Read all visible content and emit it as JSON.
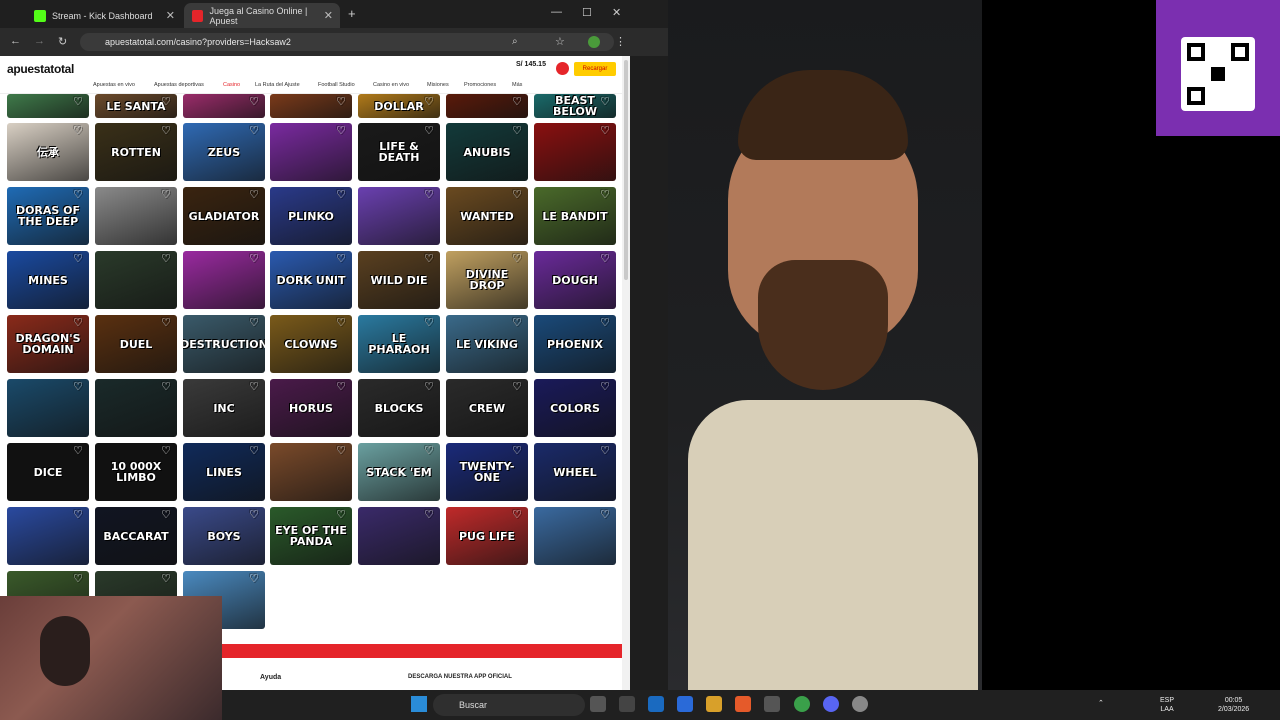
{
  "browser": {
    "tabs": [
      {
        "label": "Stream - Kick Dashboard",
        "active": false
      },
      {
        "label": "Juega al Casino Online | Apuest",
        "active": true
      }
    ],
    "url": "apuestatotal.com/casino?providers=Hacksaw2"
  },
  "site": {
    "logo": "apuestatotal",
    "nav": [
      "Apuestas en vivo",
      "Apuestas deportivas",
      "Casino",
      "La Ruta del Ajuste",
      "Football Studio",
      "Casino en vivo",
      "Misiones",
      "Promociones",
      "Más"
    ],
    "active_nav": "Casino",
    "balance": "S/ 145.15",
    "recharge_label": "Recargar"
  },
  "games": [
    {
      "title": "",
      "color": "#3f7a4a"
    },
    {
      "title": "LE SANTA",
      "color": "#6b4a2b"
    },
    {
      "title": "",
      "color": "#9a2c6a"
    },
    {
      "title": "",
      "color": "#7a3a1a"
    },
    {
      "title": "DOLLAR",
      "color": "#b07a1a"
    },
    {
      "title": "",
      "color": "#5a1a0a"
    },
    {
      "title": "BEAST BELOW",
      "color": "#1a6a6a"
    },
    {
      "title": "伝承",
      "color": "#d9d0c4"
    },
    {
      "title": "ROTTEN",
      "color": "#3a3018"
    },
    {
      "title": "ZEUS",
      "color": "#2f6ab4"
    },
    {
      "title": "",
      "color": "#7a2aa0"
    },
    {
      "title": "LIFE & DEATH",
      "color": "#1a1a1a"
    },
    {
      "title": "ANUBIS",
      "color": "#123a3a"
    },
    {
      "title": "",
      "color": "#8a1010"
    },
    {
      "title": "DORAS OF THE DEEP",
      "color": "#1f6bb5"
    },
    {
      "title": "",
      "color": "#8a8a8a"
    },
    {
      "title": "GLADIATOR",
      "color": "#3a2410"
    },
    {
      "title": "PLINKO",
      "color": "#2a3a8a"
    },
    {
      "title": "",
      "color": "#6a40b0"
    },
    {
      "title": "WANTED",
      "color": "#6a4a20"
    },
    {
      "title": "LE BANDIT",
      "color": "#4a6a2a"
    },
    {
      "title": "MINES",
      "color": "#1a4aa0"
    },
    {
      "title": "",
      "color": "#2a3a2a"
    },
    {
      "title": "",
      "color": "#9a2aa0"
    },
    {
      "title": "DORK UNIT",
      "color": "#2a5ab0"
    },
    {
      "title": "WILD DIE",
      "color": "#5a4020"
    },
    {
      "title": "DIVINE DROP",
      "color": "#c0a060"
    },
    {
      "title": "DOUGH",
      "color": "#6a2a9a"
    },
    {
      "title": "DRAGON'S DOMAIN",
      "color": "#8a2a1a"
    },
    {
      "title": "DUEL",
      "color": "#5a3010"
    },
    {
      "title": "DESTRUCTION",
      "color": "#3a5a6a"
    },
    {
      "title": "CLOWNS",
      "color": "#7a5a1a"
    },
    {
      "title": "LE PHARAOH",
      "color": "#2a7aa0"
    },
    {
      "title": "LE VIKING",
      "color": "#3a6a8a"
    },
    {
      "title": "PHOENIX",
      "color": "#1a4a7a"
    },
    {
      "title": "",
      "color": "#1a4a6a"
    },
    {
      "title": "",
      "color": "#1a2a2a"
    },
    {
      "title": "INC",
      "color": "#3a3a3a"
    },
    {
      "title": "HORUS",
      "color": "#4a1a4a"
    },
    {
      "title": "BLOCKS",
      "color": "#2a2a2a"
    },
    {
      "title": "CREW",
      "color": "#2a2a2a"
    },
    {
      "title": "COLORS",
      "color": "#1a1a5a"
    },
    {
      "title": "DICE",
      "color": "#111111"
    },
    {
      "title": "10 000X LIMBO",
      "color": "#111111"
    },
    {
      "title": "LINES",
      "color": "#102a5a"
    },
    {
      "title": "",
      "color": "#7a4a2a"
    },
    {
      "title": "STACK 'EM",
      "color": "#6aa0a0"
    },
    {
      "title": "TWENTY-ONE",
      "color": "#1a2a7a"
    },
    {
      "title": "WHEEL",
      "color": "#1a2a6a"
    },
    {
      "title": "",
      "color": "#2a4aa0"
    },
    {
      "title": "BACCARAT",
      "color": "#111522"
    },
    {
      "title": "BOYS",
      "color": "#3a4a8a"
    },
    {
      "title": "EYE OF THE PANDA",
      "color": "#2a5a2a"
    },
    {
      "title": "",
      "color": "#3a2a6a"
    },
    {
      "title": "PUG LIFE",
      "color": "#c02a2a"
    },
    {
      "title": "",
      "color": "#3a6aa0"
    },
    {
      "title": "",
      "color": "#3a5a2a"
    },
    {
      "title": "",
      "color": "#2a3a2a"
    },
    {
      "title": "",
      "color": "#4a8ac0"
    }
  ],
  "footer": {
    "help": "Ayuda",
    "download": "DESCARGA NUESTRA APP OFICIAL"
  },
  "taskbar": {
    "search_placeholder": "Buscar",
    "lang": "ESP",
    "lang2": "LAA",
    "time": "00:05",
    "date": "2/03/2026"
  }
}
